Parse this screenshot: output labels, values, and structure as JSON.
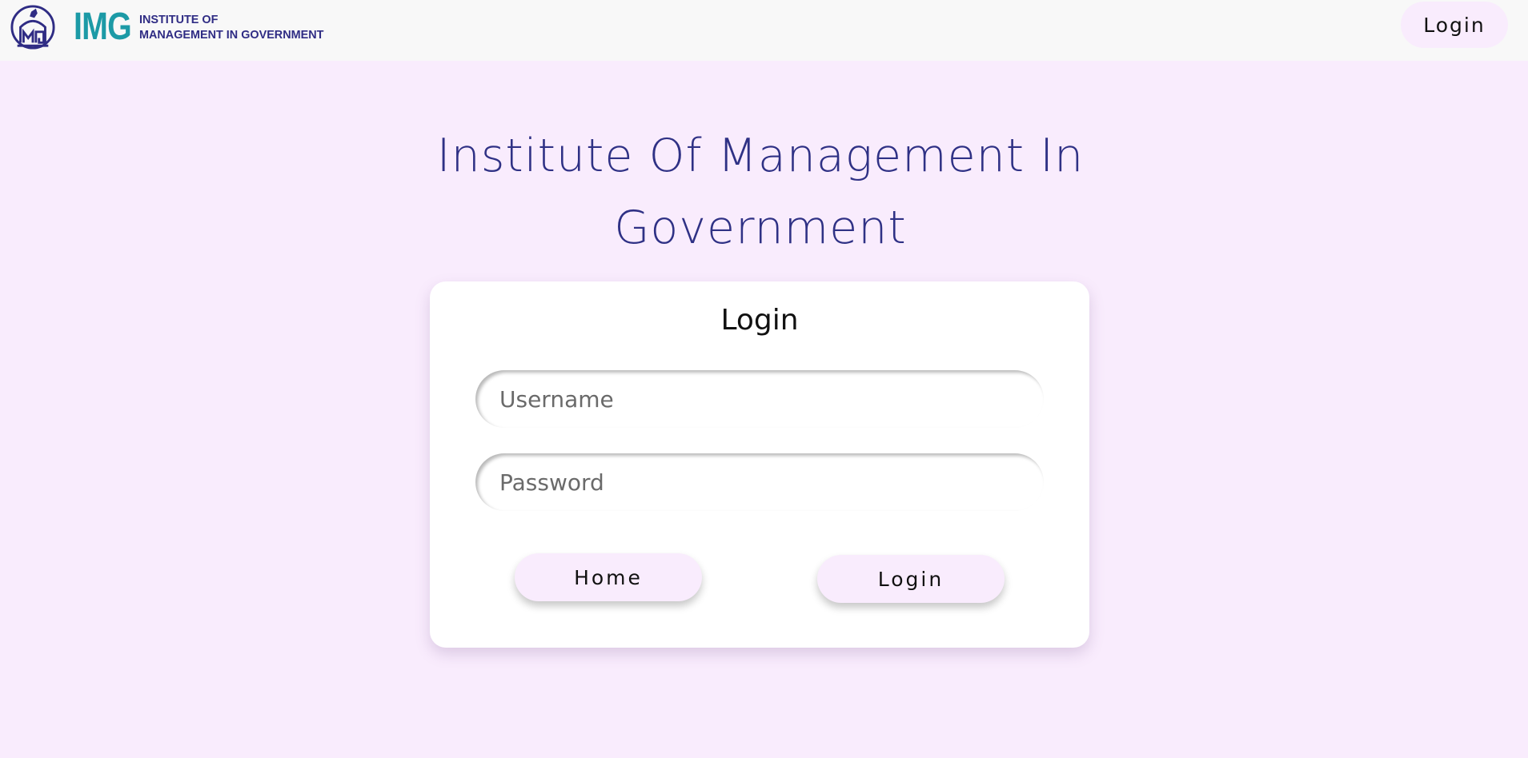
{
  "navbar": {
    "logo_abbr": "IMG",
    "logo_line1": "INSTITUTE OF",
    "logo_line2": "MANAGEMENT IN GOVERNMENT",
    "login_label": "Login"
  },
  "page": {
    "title": "Institute Of Management In Government"
  },
  "login_card": {
    "title": "Login",
    "username_placeholder": "Username",
    "password_placeholder": "Password",
    "home_label": "Home",
    "login_label": "Login"
  },
  "colors": {
    "background": "#f9ecfd",
    "navbar": "#f8f8f8",
    "title": "#2f3185",
    "logo_teal": "#1c9aa6",
    "logo_navy": "#2f2c84"
  }
}
